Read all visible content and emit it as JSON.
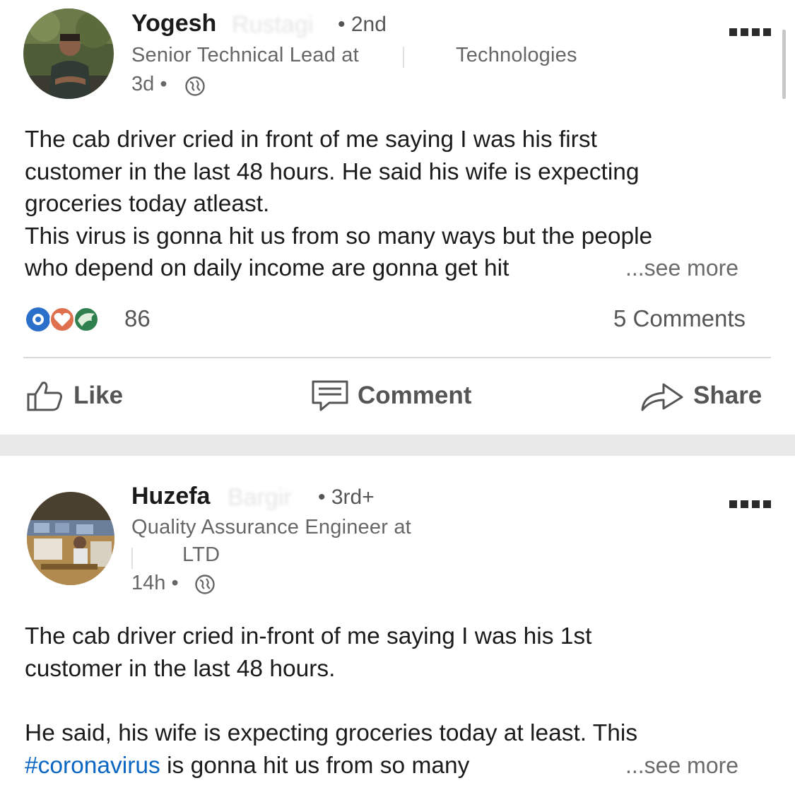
{
  "colors": {
    "accent": "#0a66c2",
    "like": "#2a6fc9",
    "love": "#df704d",
    "insightful": "#2f7f4f"
  },
  "posts": [
    {
      "author": {
        "first_name": "Yogesh",
        "last_name_blurred": "Rustagi",
        "degree": "• 2nd",
        "headline_start": "Senior Technical Lead at",
        "headline_end": "Technologies",
        "time": "3d •",
        "visibility_icon": "globe-icon"
      },
      "text": "The cab driver cried in front of me saying I was his first\ncustomer in the last 48 hours. He said his wife is expecting\ngroceries today atleast.\nThis virus is gonna hit us from so many ways but the people\nwho depend on daily income are gonna get hit",
      "see_more": "...see more",
      "reactions": {
        "icons": [
          "like-icon",
          "love-icon",
          "insightful-icon"
        ],
        "count": "86"
      },
      "comments": "5 Comments",
      "actions": {
        "like": "Like",
        "comment": "Comment",
        "share": "Share"
      }
    },
    {
      "author": {
        "first_name": "Huzefa",
        "last_name_blurred": "Bargir",
        "degree": "• 3rd+",
        "headline_start": "Quality Assurance Engineer at",
        "headline_line2": "LTD",
        "time": "14h •",
        "visibility_icon": "globe-icon"
      },
      "text_line1": "The cab driver cried in-front of me saying I was his 1st",
      "text_line2": "customer in the last 48 hours.",
      "text_line3": "He said, his wife is expecting groceries today at least. This",
      "hashtag": "#coronavirus",
      "text_line4_rest": " is gonna hit us from so many",
      "see_more": "...see more"
    }
  ]
}
